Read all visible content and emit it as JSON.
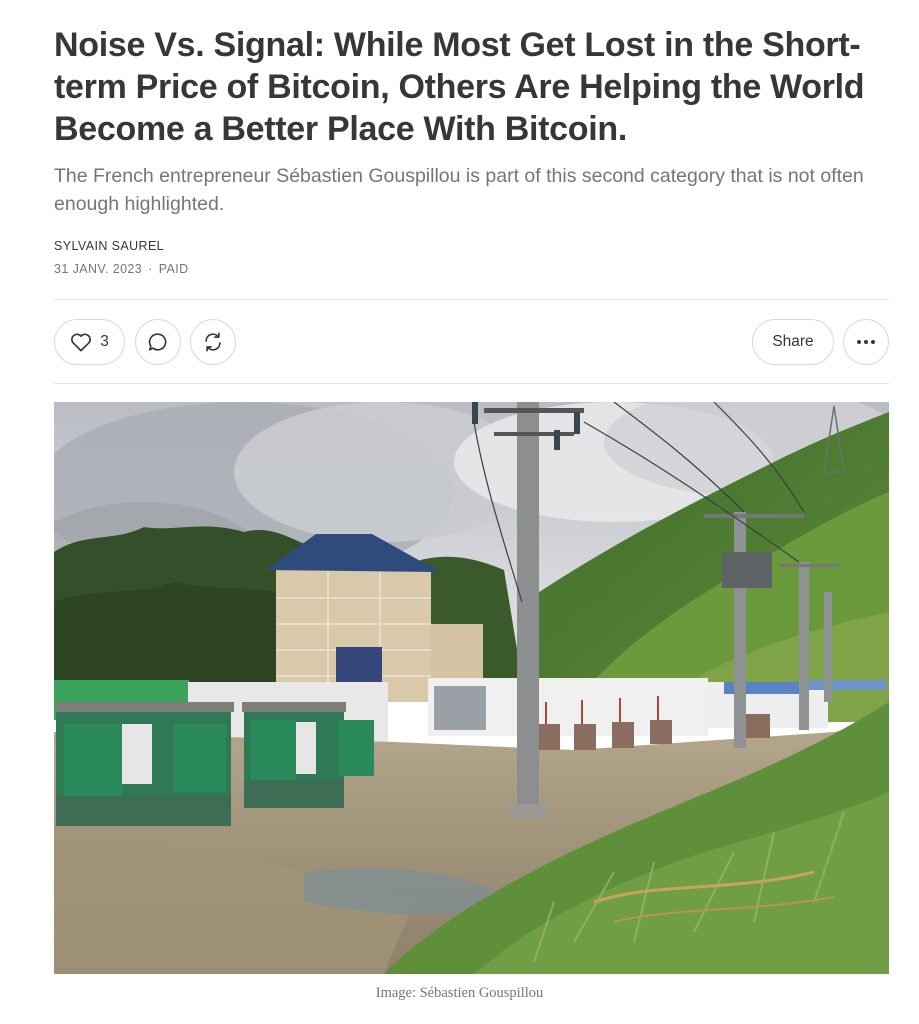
{
  "post": {
    "title": "Noise Vs. Signal: While Most Get Lost in the Short-term Price of Bitcoin, Others Are Helping the World Become a Better Place With Bitcoin.",
    "subtitle": "The French entrepreneur Sébastien Gouspillou is part of this second category that is not often enough highlighted.",
    "author": "SYLVAIN SAUREL",
    "date": "31 JANV. 2023",
    "separator": "·",
    "access": "PAID"
  },
  "actions": {
    "like_icon": "heart-icon",
    "like_count": "3",
    "comment_icon": "speech-bubble-icon",
    "restack_icon": "restack-arrows-icon",
    "share_label": "Share",
    "more_icon": "ellipsis-icon"
  },
  "image": {
    "caption": "Image: Sébastien Gouspillou"
  },
  "colors": {
    "text": "#363737",
    "muted": "#757575",
    "border": "#d9d9d9"
  }
}
